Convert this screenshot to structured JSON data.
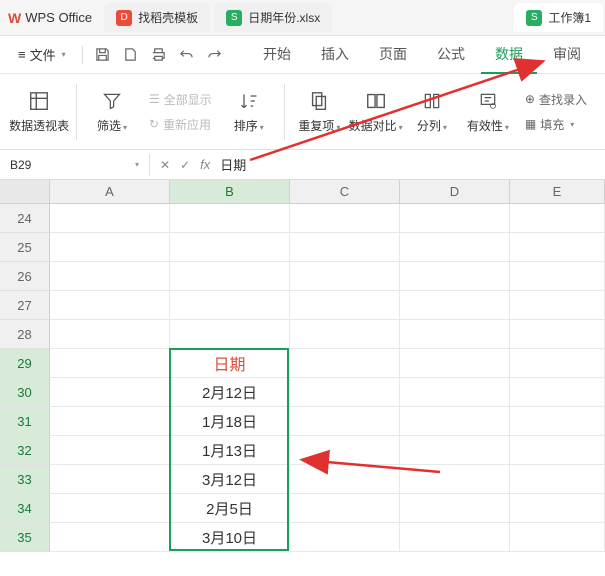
{
  "titlebar": {
    "app_name": "WPS Office",
    "tabs": [
      {
        "icon_color": "red",
        "icon_text": "D",
        "label": "找稻壳模板"
      },
      {
        "icon_color": "green",
        "icon_text": "S",
        "label": "日期年份.xlsx"
      },
      {
        "icon_color": "green",
        "icon_text": "S",
        "label": "工作簿1"
      }
    ]
  },
  "menubar": {
    "file_label": "文件",
    "tabs": [
      "开始",
      "插入",
      "页面",
      "公式",
      "数据",
      "审阅"
    ],
    "active_tab": "数据"
  },
  "ribbon": {
    "pivot": "数据透视表",
    "filter": "筛选",
    "show_all": "全部显示",
    "reapply": "重新应用",
    "sort": "排序",
    "dedup": "重复项",
    "compare": "数据对比",
    "split": "分列",
    "validate": "有效性",
    "find_input": "查找录入",
    "fill": "填充"
  },
  "formulabar": {
    "namebox": "B29",
    "formula": "日期"
  },
  "grid": {
    "columns": [
      "A",
      "B",
      "C",
      "D",
      "E"
    ],
    "row_start": 24,
    "row_end": 35,
    "active_col": "B",
    "selection": {
      "col": "B",
      "row_from": 29,
      "row_to": 35
    },
    "data": {
      "B29": {
        "value": "日期",
        "header": true
      },
      "B30": {
        "value": "2月12日"
      },
      "B31": {
        "value": "1月18日"
      },
      "B32": {
        "value": "1月13日"
      },
      "B33": {
        "value": "3月12日"
      },
      "B34": {
        "value": "2月5日"
      },
      "B35": {
        "value": "3月10日"
      }
    }
  }
}
